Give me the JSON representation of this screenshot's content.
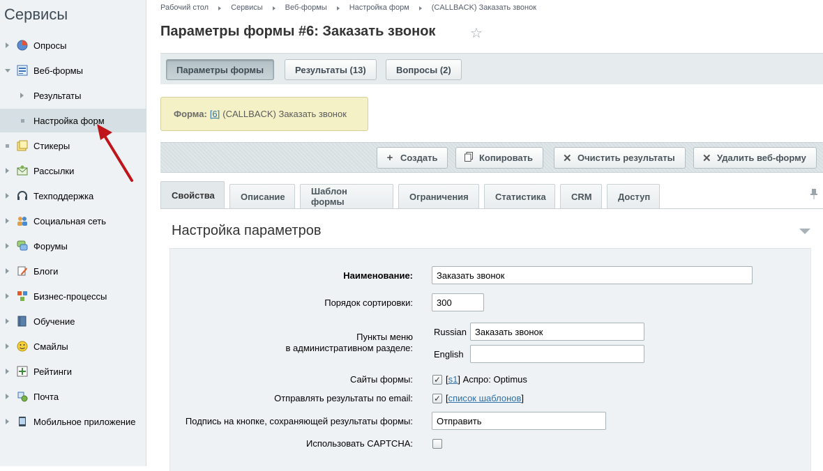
{
  "sidebar": {
    "title": "Сервисы",
    "items": [
      {
        "label": "Опросы"
      },
      {
        "label": "Веб-формы"
      },
      {
        "label": "Результаты"
      },
      {
        "label": "Настройка форм"
      },
      {
        "label": "Стикеры"
      },
      {
        "label": "Рассылки"
      },
      {
        "label": "Техподдержка"
      },
      {
        "label": "Социальная сеть"
      },
      {
        "label": "Форумы"
      },
      {
        "label": "Блоги"
      },
      {
        "label": "Бизнес-процессы"
      },
      {
        "label": "Обучение"
      },
      {
        "label": "Смайлы"
      },
      {
        "label": "Рейтинги"
      },
      {
        "label": "Почта"
      },
      {
        "label": "Мобильное приложение"
      }
    ]
  },
  "breadcrumbs": [
    "Рабочий стол",
    "Сервисы",
    "Веб-формы",
    "Настройка форм",
    "(CALLBACK) Заказать звонок"
  ],
  "page": {
    "title": "Параметры формы #6: Заказать звонок"
  },
  "top_tabs": [
    "Параметры формы",
    "Результаты (13)",
    "Вопросы (2)"
  ],
  "infobox": {
    "label": "Форма:",
    "link": "[6]",
    "text": "(CALLBACK) Заказать звонок"
  },
  "toolbar": {
    "create": "Создать",
    "copy": "Копировать",
    "clear": "Очистить результаты",
    "delete": "Удалить веб-форму"
  },
  "tabs": [
    "Свойства",
    "Описание",
    "Шаблон формы",
    "Ограничения",
    "Статистика",
    "CRM",
    "Доступ"
  ],
  "panel": {
    "title": "Настройка параметров"
  },
  "form": {
    "name_label": "Наименование:",
    "name_value": "Заказать звонок",
    "sort_label": "Порядок сортировки:",
    "sort_value": "300",
    "menu_label_1": "Пункты меню",
    "menu_label_2": "в административном разделе:",
    "menu_lang_ru": "Russian",
    "menu_value_ru": "Заказать звонок",
    "menu_lang_en": "English",
    "menu_value_en": "",
    "sites_label": "Сайты формы:",
    "sites_link": "s1",
    "sites_text": "] Аспро: Optimus",
    "email_label": "Отправлять результаты по email:",
    "email_link": "список шаблонов",
    "button_label": "Подпись на кнопке, сохраняющей результаты формы:",
    "button_value": "Отправить",
    "captcha_label": "Использовать CAPTCHA:"
  },
  "colors": {
    "annotation_arrow": "#c0141b",
    "info_bg": "#f4f1c6",
    "sidebar_bg": "#eef2f4"
  }
}
